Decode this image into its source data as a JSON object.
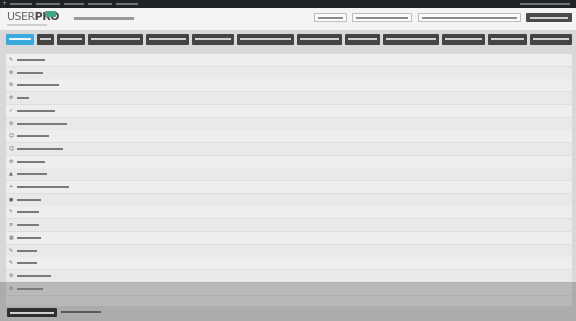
{
  "admin_bar": {
    "add_glyph": "+"
  },
  "logo": {
    "text_a": "USER",
    "text_b": "PRO",
    "badge_color": "#3daa7f"
  },
  "header": {
    "left_link": "",
    "buttons": [
      "",
      "",
      "",
      ""
    ]
  },
  "tabs": {
    "active_color": "#3aa9dd",
    "items": [
      "",
      "",
      "",
      "",
      "",
      "",
      "",
      "",
      "",
      "",
      "",
      "",
      "",
      "",
      "",
      "",
      "",
      ""
    ]
  },
  "rows": [
    {
      "icon": "wrench-icon",
      "glyph": "✎",
      "label": ""
    },
    {
      "icon": "gear-icon",
      "glyph": "⚙",
      "label": ""
    },
    {
      "icon": "gears-icon",
      "glyph": "⚙",
      "label": ""
    },
    {
      "icon": "gears-icon",
      "glyph": "⚙",
      "label": ""
    },
    {
      "icon": "check-icon",
      "glyph": "✓",
      "label": ""
    },
    {
      "icon": "gears-icon",
      "glyph": "⚙",
      "label": ""
    },
    {
      "icon": "user-icon",
      "glyph": "☺",
      "label": ""
    },
    {
      "icon": "users-icon",
      "glyph": "☺",
      "label": ""
    },
    {
      "icon": "gears-icon",
      "glyph": "⚙",
      "label": ""
    },
    {
      "icon": "lock-icon",
      "glyph": "▲",
      "label": ""
    },
    {
      "icon": "plus-icon",
      "glyph": "+",
      "label": ""
    },
    {
      "icon": "lock-icon",
      "glyph": "●",
      "label": ""
    },
    {
      "icon": "bolt-icon",
      "glyph": "ϟ",
      "label": ""
    },
    {
      "icon": "bars-icon",
      "glyph": "≡",
      "label": ""
    },
    {
      "icon": "grid-icon",
      "glyph": "▦",
      "label": ""
    },
    {
      "icon": "pencil-icon",
      "glyph": "✎",
      "label": ""
    },
    {
      "icon": "pencil-icon",
      "glyph": "✎",
      "label": ""
    },
    {
      "icon": "gears-icon",
      "glyph": "⚙",
      "label": ""
    },
    {
      "icon": "gears-icon",
      "glyph": "⚙",
      "label": ""
    }
  ],
  "footer": {
    "save_label": "",
    "reset_label": ""
  }
}
